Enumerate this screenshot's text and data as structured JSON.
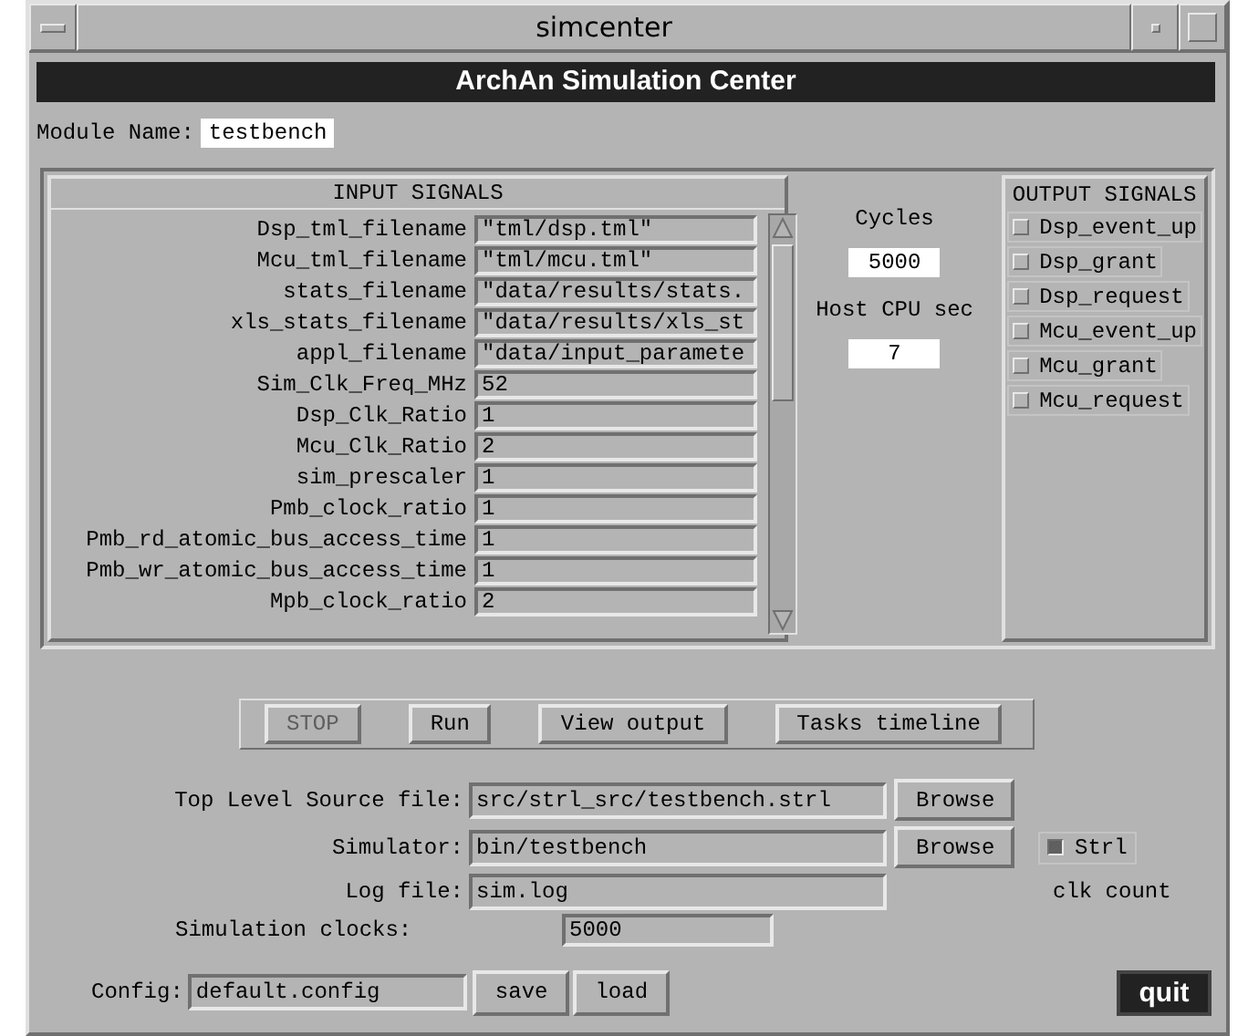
{
  "window": {
    "title": "simcenter"
  },
  "header": "ArchAn Simulation Center",
  "module": {
    "label": "Module Name:",
    "value": "testbench"
  },
  "input_signals": {
    "title": "INPUT SIGNALS",
    "rows": [
      {
        "name": "Dsp_tml_filename",
        "value": "\"tml/dsp.tml\""
      },
      {
        "name": "Mcu_tml_filename",
        "value": "\"tml/mcu.tml\""
      },
      {
        "name": "stats_filename",
        "value": "\"data/results/stats."
      },
      {
        "name": "xls_stats_filename",
        "value": "\"data/results/xls_st"
      },
      {
        "name": "appl_filename",
        "value": "\"data/input_paramete"
      },
      {
        "name": "Sim_Clk_Freq_MHz",
        "value": "52"
      },
      {
        "name": "Dsp_Clk_Ratio",
        "value": "1"
      },
      {
        "name": "Mcu_Clk_Ratio",
        "value": "2"
      },
      {
        "name": "sim_prescaler",
        "value": "1"
      },
      {
        "name": "Pmb_clock_ratio",
        "value": "1"
      },
      {
        "name": "Pmb_rd_atomic_bus_access_time",
        "value": "1"
      },
      {
        "name": "Pmb_wr_atomic_bus_access_time",
        "value": "1"
      },
      {
        "name": "Mpb_clock_ratio",
        "value": "2"
      }
    ]
  },
  "stats": [
    {
      "label": "Cycles",
      "value": "5000"
    },
    {
      "label": "Host CPU sec",
      "value": "7"
    }
  ],
  "output_signals": {
    "title": "OUTPUT SIGNALS",
    "items": [
      {
        "label": "Dsp_event_up",
        "checked": false
      },
      {
        "label": "Dsp_grant",
        "checked": false
      },
      {
        "label": "Dsp_request",
        "checked": false
      },
      {
        "label": "Mcu_event_up",
        "checked": false
      },
      {
        "label": "Mcu_grant",
        "checked": false
      },
      {
        "label": "Mcu_request",
        "checked": false
      }
    ]
  },
  "controls": [
    {
      "label": "STOP",
      "disabled": true
    },
    {
      "label": "Run",
      "disabled": false
    },
    {
      "label": "View output",
      "disabled": false
    },
    {
      "label": "Tasks timeline",
      "disabled": false
    }
  ],
  "files": [
    {
      "label": "Top Level Source file:",
      "value": "src/strl_src/testbench.strl",
      "button": "Browse"
    },
    {
      "label": "Simulator:",
      "value": "bin/testbench",
      "button": "Browse"
    },
    {
      "label": "Log file:",
      "value": "sim.log"
    }
  ],
  "strl": {
    "label": "Strl",
    "checked": true
  },
  "clk_count": "clk count",
  "sim_clocks": {
    "label": "Simulation clocks:",
    "value": "5000"
  },
  "config": {
    "label": "Config:",
    "value": "default.config",
    "buttons": [
      "save",
      "load"
    ]
  },
  "quit": "quit"
}
